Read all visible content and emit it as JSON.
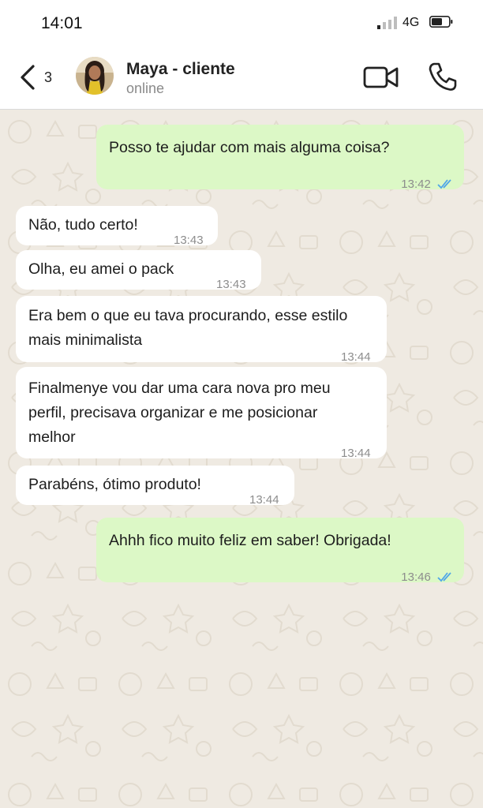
{
  "status_bar": {
    "time": "14:01",
    "network": "4G"
  },
  "header": {
    "back_count": "3",
    "contact_name": "Maya - cliente",
    "presence": "online"
  },
  "messages": [
    {
      "direction": "outgoing",
      "text": "Posso te ajudar com mais alguma coisa?",
      "time": "13:42",
      "read": true
    },
    {
      "direction": "incoming",
      "text": "Não, tudo certo!",
      "time": "13:43"
    },
    {
      "direction": "incoming",
      "text": "Olha, eu amei o pack",
      "time": "13:43"
    },
    {
      "direction": "incoming",
      "text": "Era bem o que eu tava procurando, esse estilo mais minimalista",
      "time": "13:44"
    },
    {
      "direction": "incoming",
      "text": "Finalmenye vou dar uma cara nova pro meu perfil, precisava organizar e me posicionar melhor",
      "time": "13:44"
    },
    {
      "direction": "incoming",
      "text": "Parabéns, ótimo produto!",
      "time": "13:44"
    },
    {
      "direction": "outgoing",
      "text": "Ahhh fico muito feliz em saber! Obrigada!",
      "time": "13:46",
      "read": true
    }
  ],
  "colors": {
    "outgoing_bubble": "#dcf8c6",
    "incoming_bubble": "#ffffff",
    "chat_background": "#efeae2",
    "read_tick": "#4fa6e8"
  }
}
